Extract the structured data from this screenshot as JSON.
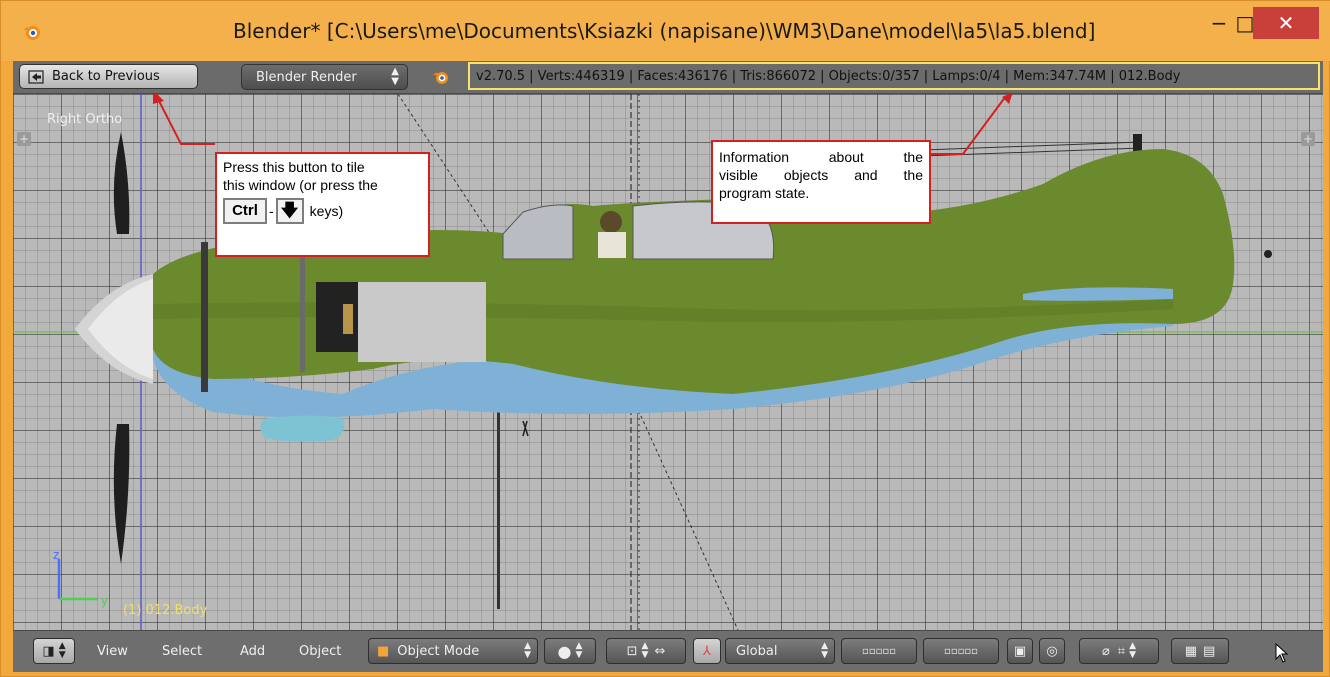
{
  "window": {
    "title": "Blender* [C:\\Users\\me\\Documents\\Ksiazki (napisane)\\WM3\\Dane\\model\\la5\\la5.blend]",
    "minimize_glyph": "−",
    "maximize_glyph": "□",
    "close_glyph": "✕"
  },
  "header": {
    "back_button_label": "Back to Previous",
    "render_engine": "Blender Render",
    "info_text": "v2.70.5 | Verts:446319 | Faces:436176 | Tris:866072 | Objects:0/357 | Lamps:0/4 | Mem:347.74M | 012.Body"
  },
  "viewport": {
    "view_name": "Right Ortho",
    "active_object_label": "(1) 012.Body",
    "axis_z": "z",
    "axis_y": "y",
    "plus_glyph": "+"
  },
  "annotations": {
    "tile_hint_line1": "Press this button to tile",
    "tile_hint_line2": "this window (or press the",
    "key_ctrl": "Ctrl",
    "key_dash": "-",
    "key_down": "🡇",
    "keys_suffix": "keys)",
    "info_hint_line1": "Information about the",
    "info_hint_line2": "visible objects and the",
    "info_hint_line3": "program state."
  },
  "footer": {
    "menus": [
      "View",
      "Select",
      "Add",
      "Object"
    ],
    "mode": "Object Mode",
    "orientation": "Global"
  },
  "colors": {
    "titlebar": "#f4b04a",
    "close_button": "#c9403b",
    "annotation_border": "#d42020",
    "info_highlight": "#f5e36b",
    "fuselage_green": "#6b8a2e",
    "belly_blue": "#7fb1d6"
  }
}
